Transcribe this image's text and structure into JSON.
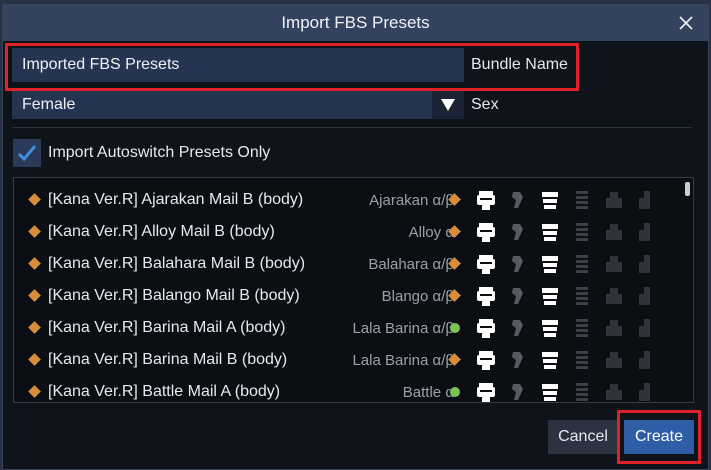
{
  "window": {
    "title": "Import FBS Presets"
  },
  "bundle": {
    "value": "Imported FBS Presets",
    "label": "Bundle Name"
  },
  "sex": {
    "selected": "Female",
    "label": "Sex"
  },
  "autoswitch": {
    "label": "Import Autoswitch Presets Only",
    "checked": true
  },
  "presets": [
    {
      "name": "[Kana Ver.R] Ajarakan Mail B (body)",
      "alias": "Ajarakan α/β",
      "status": "diamond"
    },
    {
      "name": "[Kana Ver.R] Alloy Mail B (body)",
      "alias": "Alloy α",
      "status": "diamond"
    },
    {
      "name": "[Kana Ver.R] Balahara Mail B (body)",
      "alias": "Balahara α/β",
      "status": "diamond"
    },
    {
      "name": "[Kana Ver.R] Balango Mail B (body)",
      "alias": "Blango α/β",
      "status": "diamond"
    },
    {
      "name": "[Kana Ver.R] Barina Mail A (body)",
      "alias": "Lala Barina α/β",
      "status": "dot"
    },
    {
      "name": "[Kana Ver.R] Barina Mail B (body)",
      "alias": "Lala Barina α/β",
      "status": "diamond"
    },
    {
      "name": "[Kana Ver.R] Battle Mail A (body)",
      "alias": "Battle α",
      "status": "dot"
    }
  ],
  "buttons": {
    "cancel": "Cancel",
    "create": "Create"
  },
  "colors": {
    "highlight": "#e0202a",
    "accent": "#2f5ea7",
    "status_diamond": "#d98c3e",
    "status_dot": "#7cc35a"
  }
}
